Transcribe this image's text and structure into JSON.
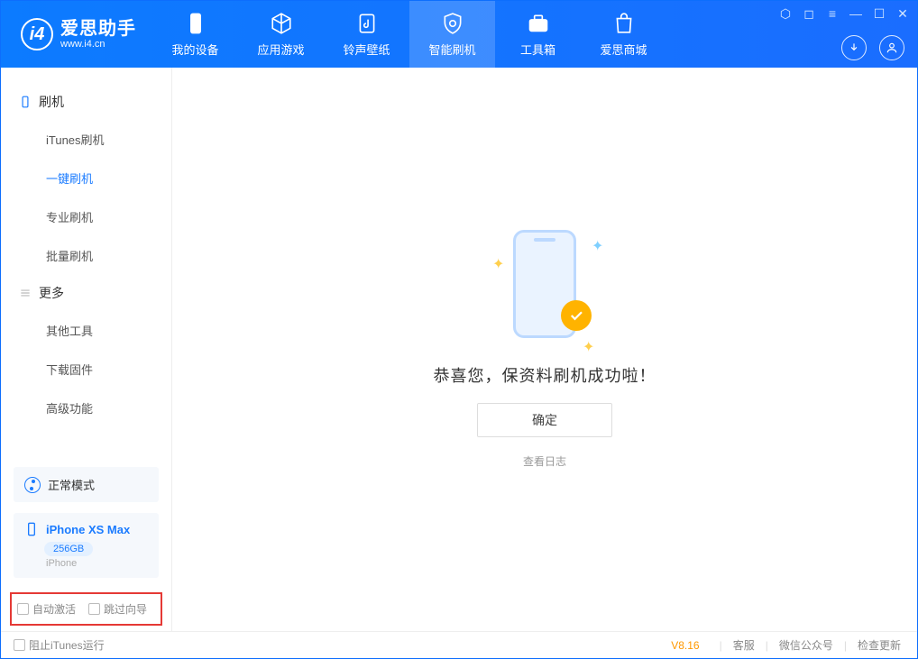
{
  "logo": {
    "title": "爱思助手",
    "subtitle": "www.i4.cn"
  },
  "nav": {
    "items": [
      {
        "label": "我的设备"
      },
      {
        "label": "应用游戏"
      },
      {
        "label": "铃声壁纸"
      },
      {
        "label": "智能刷机"
      },
      {
        "label": "工具箱"
      },
      {
        "label": "爱思商城"
      }
    ]
  },
  "sidebar": {
    "section1_title": "刷机",
    "section1_items": [
      "iTunes刷机",
      "一键刷机",
      "专业刷机",
      "批量刷机"
    ],
    "section2_title": "更多",
    "section2_items": [
      "其他工具",
      "下载固件",
      "高级功能"
    ],
    "mode_label": "正常模式",
    "device_name": "iPhone XS Max",
    "capacity": "256GB",
    "device_type": "iPhone",
    "chk_auto_activate": "自动激活",
    "chk_skip_guide": "跳过向导"
  },
  "main": {
    "success_text": "恭喜您，保资料刷机成功啦！",
    "confirm": "确定",
    "view_log": "查看日志"
  },
  "footer": {
    "block_itunes": "阻止iTunes运行",
    "version": "V8.16",
    "links": [
      "客服",
      "微信公众号",
      "检查更新"
    ]
  }
}
